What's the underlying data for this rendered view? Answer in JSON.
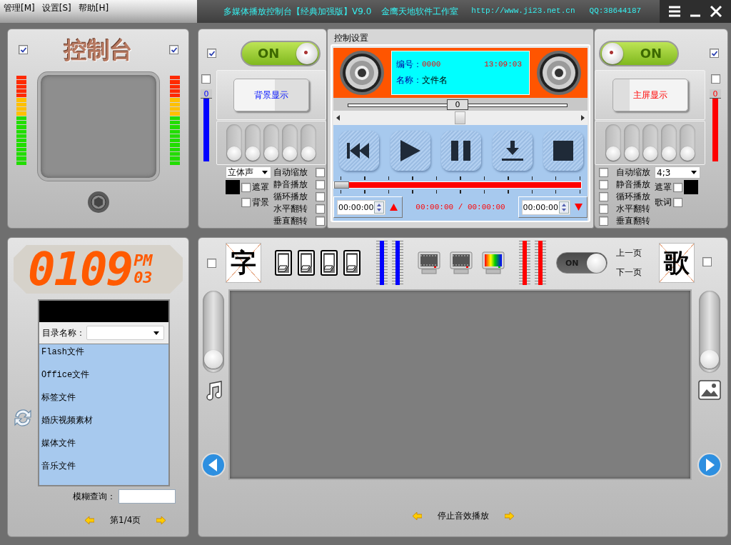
{
  "menu": [
    {
      "label": "管理[M]"
    },
    {
      "label": "设置[S]"
    },
    {
      "label": "帮助[H]"
    }
  ],
  "title_bar": {
    "title": "多媒体播放控制台【经典加强版】V9.0",
    "company": "金鹰天地软件工作室",
    "url": "http://www.ji23.net.cn",
    "qq": "QQ:38644187"
  },
  "console": {
    "title": "控制台",
    "checkboxes": [
      {
        "checked": true
      },
      {
        "checked": true
      }
    ],
    "meters": [
      {
        "level": 1
      },
      {
        "level": 1
      }
    ]
  },
  "left_deck": {
    "corner_checkbox": {
      "checked": true
    },
    "power": {
      "label": "ON",
      "on": true
    },
    "volume_checkbox": {
      "checked": false
    },
    "volume": {
      "reading": "0",
      "level": 1
    },
    "display_button": "背景显示",
    "sliders": [
      {
        "level": 0
      },
      {
        "level": 0
      },
      {
        "level": 0
      },
      {
        "level": 0
      },
      {
        "level": 0
      }
    ],
    "dropdown": "立体声",
    "options": [
      {
        "label": "遮罩",
        "checked": false
      },
      {
        "label": "背景",
        "checked": false
      }
    ],
    "toggles": [
      {
        "label": "自动缩放",
        "checked": false
      },
      {
        "label": "静音播放",
        "checked": false
      },
      {
        "label": "循环播放",
        "checked": false
      },
      {
        "label": "水平翻转",
        "checked": false
      },
      {
        "label": "垂直翻转",
        "checked": false
      }
    ]
  },
  "player": {
    "group_title": "控制设置",
    "number_label": "编号：",
    "number": "0000",
    "clock": "13:09:03",
    "name_label": "名称：",
    "name": "文件名",
    "balance": {
      "reading": "0",
      "level": 0.5
    },
    "transport": [
      {
        "kind": "previous"
      },
      {
        "kind": "play"
      },
      {
        "kind": "pause"
      },
      {
        "kind": "download"
      },
      {
        "kind": "stop"
      }
    ],
    "progress": {
      "level": 0
    },
    "start_time": "00:00:00",
    "elapsed": "00:00:00 / 00:00:00",
    "end_time": "00:00:00"
  },
  "right_deck": {
    "corner_checkbox": {
      "checked": true
    },
    "power": {
      "label": "ON",
      "on": true
    },
    "volume_checkbox": {
      "checked": false
    },
    "volume": {
      "reading": "0",
      "level": 1
    },
    "display_button": "主屏显示",
    "sliders": [
      {
        "level": 0
      },
      {
        "level": 0
      },
      {
        "level": 0
      },
      {
        "level": 0
      },
      {
        "level": 0
      }
    ],
    "dropdown": "4;3",
    "options": [
      {
        "label": "遮罩",
        "checked": false
      },
      {
        "label": "歌词",
        "checked": false
      }
    ],
    "toggles": [
      {
        "label": "自动缩放",
        "checked": false
      },
      {
        "label": "静音播放",
        "checked": false
      },
      {
        "label": "循环播放",
        "checked": false
      },
      {
        "label": "水平翻转",
        "checked": false
      },
      {
        "label": "垂直翻转",
        "checked": false
      }
    ]
  },
  "clock": {
    "time": "0109",
    "meridiem": "PM",
    "seconds": "03"
  },
  "library": {
    "directory_label": "目录名称：",
    "items": [
      {
        "label": "Flash文件"
      },
      {
        "label": "Office文件"
      },
      {
        "label": "标签文件"
      },
      {
        "label": "婚庆视频素材"
      },
      {
        "label": "媒体文件"
      },
      {
        "label": "音乐文件"
      }
    ],
    "search_label": "模糊查询：",
    "page": "第1/4页"
  },
  "stage": {
    "checkboxes": [
      {
        "checked": false
      },
      {
        "checked": false
      }
    ],
    "left_tile": "字",
    "meters": [
      {
        "level": 1,
        "color": "#0000ff"
      },
      {
        "level": 1,
        "color": "#0000ff"
      },
      {
        "level": 1,
        "color": "#ff0000"
      },
      {
        "level": 1,
        "color": "#ff0000"
      }
    ],
    "effect_switch": {
      "label": "ON",
      "on": true
    },
    "page_up": "上一页",
    "page_down": "下一页",
    "right_tile": "歌",
    "sliders": [
      {
        "level": 0.05
      },
      {
        "level": 0.05
      }
    ],
    "status": "停止音效播放"
  }
}
